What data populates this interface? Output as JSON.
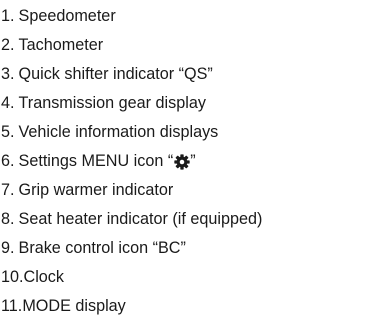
{
  "items": [
    {
      "number": "1.",
      "label": "Speedometer"
    },
    {
      "number": "2.",
      "label": "Tachometer"
    },
    {
      "number": "3.",
      "label": "Quick shifter indicator “QS”"
    },
    {
      "number": "4.",
      "label": "Transmission gear display"
    },
    {
      "number": "5.",
      "label": "Vehicle information displays"
    },
    {
      "number": "6.",
      "label_before": "Settings MENU icon “",
      "icon": "gear-icon",
      "label_after": "”"
    },
    {
      "number": "7.",
      "label": "Grip warmer indicator"
    },
    {
      "number": "8.",
      "label": "Seat heater indicator (if equipped)"
    },
    {
      "number": "9.",
      "label": "Brake control icon “BC”"
    },
    {
      "number": "10.",
      "label": "Clock"
    },
    {
      "number": "11.",
      "label": "MODE display"
    }
  ]
}
